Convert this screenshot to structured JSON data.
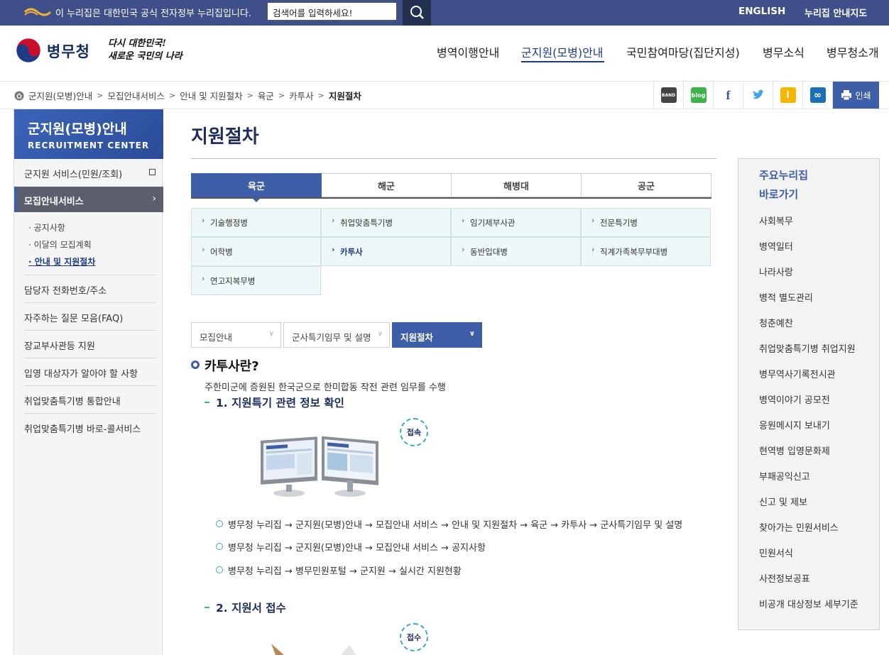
{
  "topbar": {
    "notice": "이 누리집은 대한민국 공식 전자정부 누리집입니다.",
    "search_placeholder": "검색어를 입력하세요!",
    "english": "ENGLISH",
    "guide": "누리집 안내지도"
  },
  "header": {
    "logo_text": "병무청",
    "slogan_line1": "다시 대한민국!",
    "slogan_line2": "새로운 국민의 나라",
    "gnb": [
      "병역이행안내",
      "군지원(모병)안내",
      "국민참여마당(집단지성)",
      "병무소식",
      "병무청소개"
    ]
  },
  "breadcrumb": [
    "군지원(모병)안내",
    "모집안내서비스",
    "안내 및 지원절차",
    "육군",
    "카투사",
    "지원절차"
  ],
  "breadcrumb_sep": ">",
  "sns": {
    "band": "BAND",
    "blog": "blog",
    "facebook": "f",
    "twitter": "t",
    "story": "i",
    "link": "∞",
    "print": "인쇄"
  },
  "lnb": {
    "title": "군지원(모병)안내",
    "subtitle": "RECRUITMENT CENTER",
    "item1": "군지원 서비스(민원/조회)",
    "active": "모집안내서비스",
    "subs": [
      "공지사항",
      "이달의 모집계획",
      "안내 및 지원절차"
    ],
    "items": [
      "담당자 전화번호/주소",
      "자주하는 질문 모음(FAQ)",
      "장교부사관등 지원",
      "입영 대상자가 알아야 할 사항",
      "취업맞춤특기병 통합안내",
      "취업맞춤특기병 바로-콜서비스"
    ]
  },
  "main": {
    "title": "지원절차",
    "tabs": [
      "육군",
      "해군",
      "해병대",
      "공군"
    ],
    "cells": [
      "기술행정병",
      "취업맞춤특기병",
      "임기제부사관",
      "전문특기병",
      "어학병",
      "카투사",
      "동반입대병",
      "직계가족복무부대병",
      "연고지복무병"
    ],
    "dropdowns": [
      "모집안내",
      "군사특기임무 및 설명",
      "지원절차"
    ],
    "h3": "카투사란?",
    "desc": "주한미군에 증원된 한국군으로 한미합동 작전 관련 임무를 수행",
    "step1": "1. 지원특기 관련 정보 확인",
    "badge1": "접속",
    "links": [
      "병무청 누리집 → 군지원(모병)안내 → 모집안내 서비스 → 안내 및 지원절차 → 육군 → 카투사 → 군사특기임무 및 설명",
      "병무청 누리집 → 군지원(모병)안내 → 모집안내 서비스 → 공지사항",
      "병무청 누리집 → 병무민원포털 → 군지원 → 실시간 지원현황"
    ],
    "step2": "2. 지원서 접수",
    "badge2": "접수"
  },
  "quick": {
    "title_line1": "주요누리집",
    "title_line2": "바로가기",
    "items": [
      "사회복무",
      "병역일터",
      "나라사랑",
      "병적 별도관리",
      "청춘예찬",
      "취업맞춤특기병 취업지원",
      "병무역사기록전시관",
      "병역이야기 공모전",
      "응원메시지 보내기",
      "현역병 입영문화제",
      "부패공익신고",
      "신고 및 제보",
      "찾아가는 민원서비스",
      "민원서식",
      "사전정보공표",
      "비공개 대상정보 세부기준"
    ]
  },
  "colors": {
    "topbar": "#3e4f8a",
    "accent": "#3f5ea8",
    "title": "#1e2f5f",
    "cell_bg": "#eef8f9"
  }
}
